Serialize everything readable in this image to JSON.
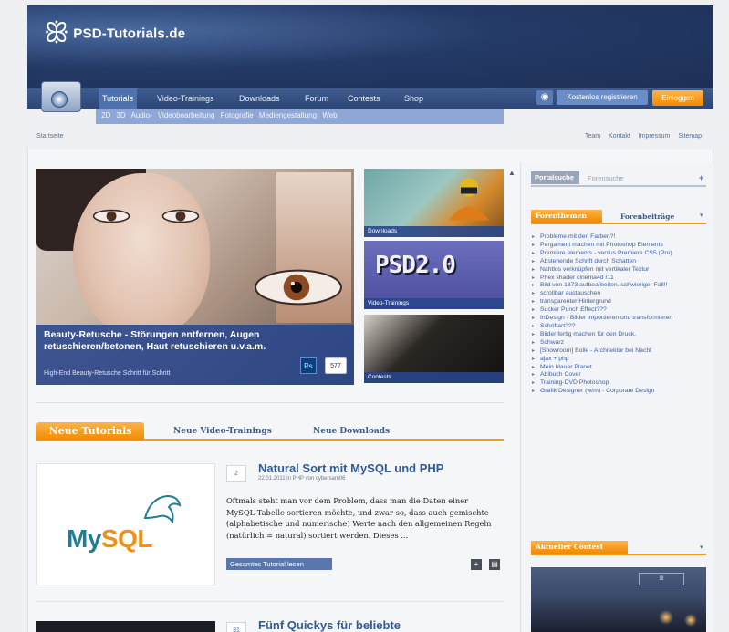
{
  "site": {
    "logo_text": "PSD-Tutorials.de",
    "logo_glyph": "ꕥ"
  },
  "nav": {
    "tabs": [
      "Tutorials",
      "Video-Trainings",
      "Downloads",
      "Forum",
      "Contests",
      "Shop"
    ],
    "sub_items": [
      "2D",
      "3D",
      "Audio-",
      "Videobearbeitung",
      "Fotografie",
      "Mediengestaltung",
      "Web"
    ]
  },
  "account": {
    "eye_icon": "eye-icon",
    "register_label": "Kostenlos registrieren",
    "login_label": "Einloggen"
  },
  "breadcrumb": "Startseite",
  "utility": [
    "Team",
    "Kontakt",
    "Impressum",
    "Sitemap"
  ],
  "hero": {
    "title": "Beauty-Retusche - Störungen entfernen, Augen retuschieren/betonen, Haut retuschieren u.v.a.m.",
    "subtitle": "High-End Beauty-Retusche Schritt für Schritt",
    "ps_badge": "Ps",
    "comment_count": "577"
  },
  "thumbs": [
    {
      "label": "Downloads"
    },
    {
      "label": "Video-Trainings",
      "big_text": "PSD2.0"
    },
    {
      "label": "Contests"
    }
  ],
  "tabs": {
    "active": "Neue Tutorials",
    "videos": "Neue Video-Trainings",
    "downloads": "Neue Downloads"
  },
  "articles": [
    {
      "num": "2",
      "title": "Natural Sort mit MySQL und PHP",
      "meta": "22.01.2011 in PHP von cybersam06",
      "text": "Oftmals steht man vor dem Problem, dass man die Daten einer MySQL-Tabelle sortieren möchte, und zwar so, dass auch gemischte (alphabetische und numerische) Werte nach den allgemeinen Regeln (natürlich = natural) sortiert werden. Dieses ...",
      "read_more": "Gesamtes Tutorial lesen",
      "logo_a": "My",
      "logo_b": "SQL"
    },
    {
      "num": "31",
      "title": "Fünf Quickys für beliebte"
    }
  ],
  "sidebar": {
    "portal_tab": "Portalsuche",
    "forum_tab": "Forensuche",
    "plus": "+",
    "topics_tab": "Forenthemen",
    "posts_tab": "Forenbeiträge",
    "arrow": "▾",
    "topics": [
      "Probleme mit den Farben?!",
      "Pergament machen mit Photoshop Elements",
      "Premiere elements - versus Premiere CS5 (Pro)",
      "Abstehende Schrift durch Schatten",
      "Nahtlos verknüpfen mit vertikaler Textur",
      "Phex shader cinema4d r11",
      "Bild von 1873 aufbearbeiten..schwieriger Fall!!",
      "scrollbar austauschen",
      "transparenter Hintergrund",
      "Sucker Punch Effect???",
      "InDesign - Bilder importieren und transformieren",
      "Schriftart???",
      "Bilder fertig machen für den Druck.",
      "Schwarz",
      "[Showroom] Bolle - Architektur bei Nacht",
      "ajax + php",
      "Mein blauer Planet",
      "Abibuch Cover",
      "Training-DVD Photoshop",
      "Grafik Designer (w/m) - Corporate Design"
    ],
    "contest_tab": "Aktueller Contest"
  }
}
